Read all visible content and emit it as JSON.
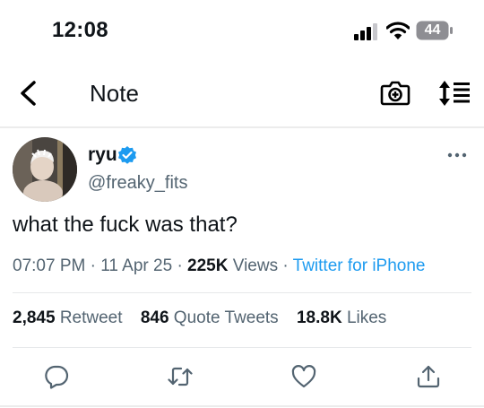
{
  "status_bar": {
    "time": "12:08",
    "battery": "44"
  },
  "nav": {
    "title": "Note"
  },
  "tweet": {
    "display_name": "ryu",
    "handle": "@freaky_fits",
    "text": "what the fuck was that?",
    "time": "07:07 PM",
    "date": "11 Apr 25",
    "views_count": "225K",
    "views_label": "Views",
    "source": "Twitter for iPhone",
    "separator": "·"
  },
  "stats": {
    "retweets_count": "2,845",
    "retweets_label": "Retweet",
    "quotes_count": "846",
    "quotes_label": "Quote Tweets",
    "likes_count": "18.8K",
    "likes_label": "Likes"
  },
  "colors": {
    "accent": "#1d9bf0",
    "muted": "#536471",
    "text": "#0f1419"
  },
  "icons": [
    "back-icon",
    "camera-icon",
    "sort-icon",
    "verified-icon",
    "more-icon",
    "reply-icon",
    "retweet-icon",
    "like-icon",
    "share-icon"
  ]
}
